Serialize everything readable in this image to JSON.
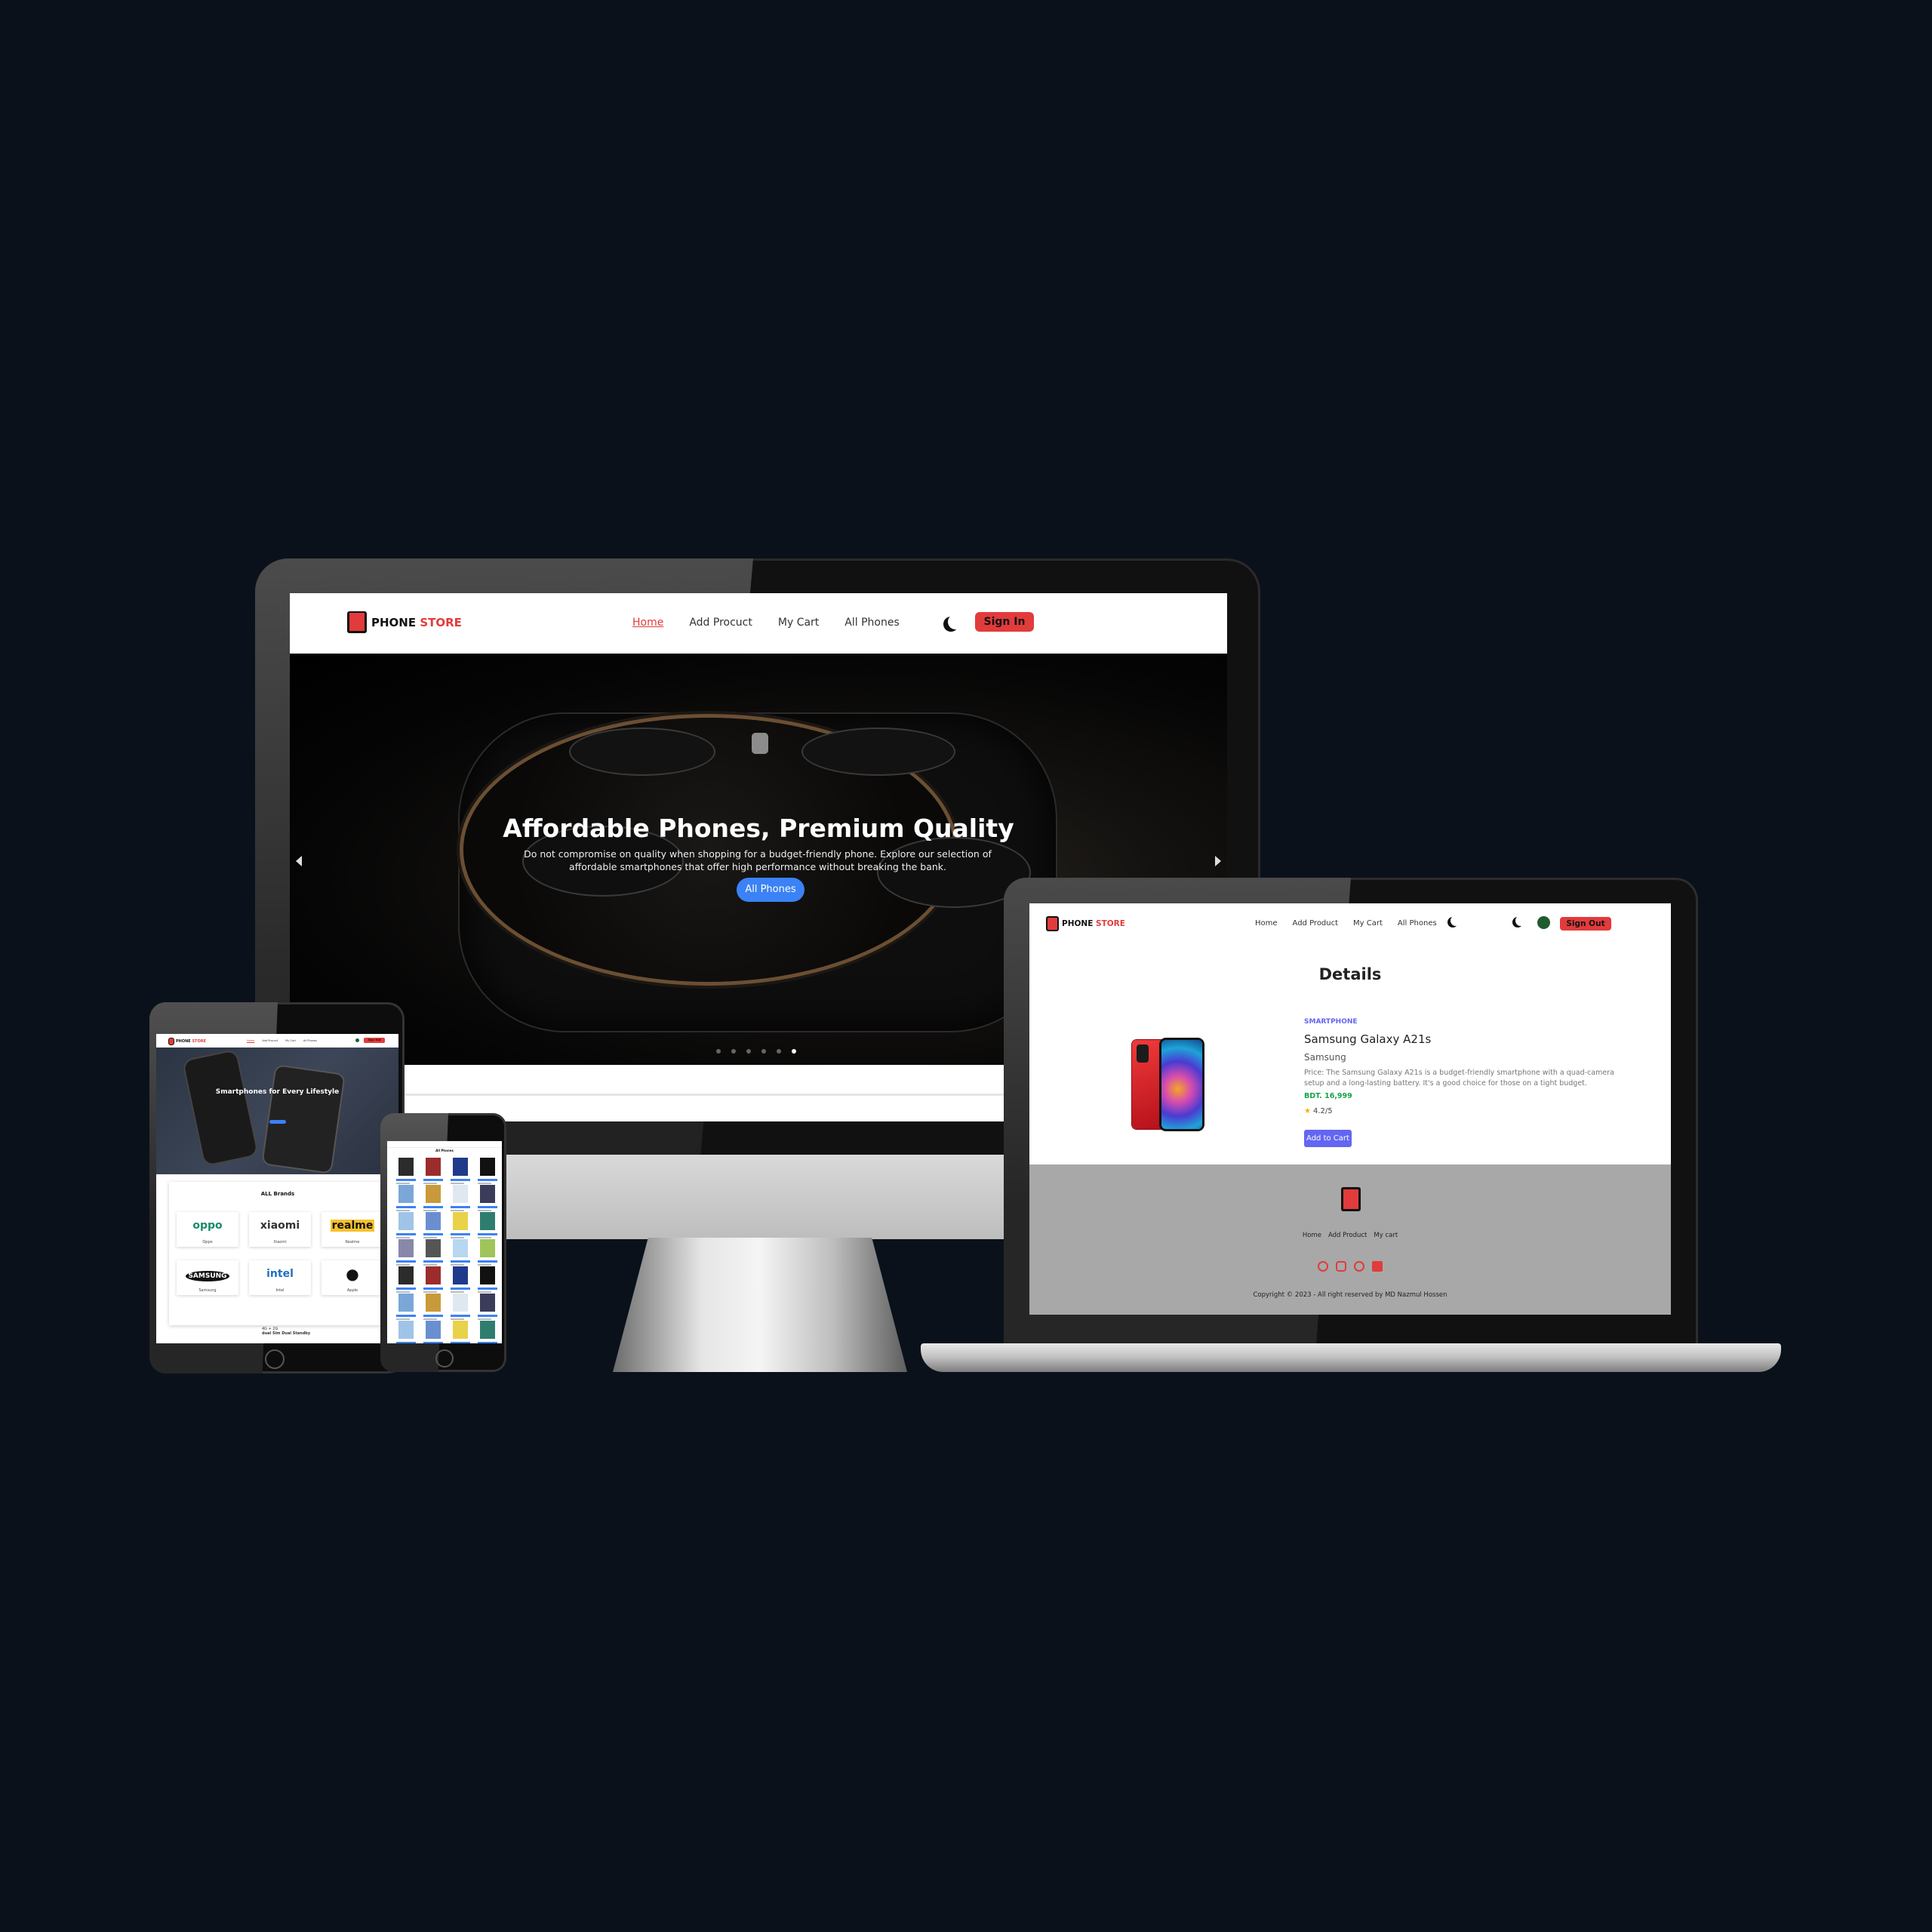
{
  "brand": {
    "name_part1": "PHONE",
    "name_part2": "STORE"
  },
  "desktop": {
    "nav": [
      "Home",
      "Add Procuct",
      "My Cart",
      "All Phones"
    ],
    "signin_label": "Sign In",
    "hero": {
      "title": "Affordable Phones, Premium Quality",
      "subtitle": "Do not compromise on quality when shopping for a budget-friendly phone. Explore our selection of affordable smartphones that offer high performance without breaking the bank.",
      "button": "All Phones",
      "slide_count": 6,
      "active_slide": 6
    }
  },
  "laptop": {
    "nav": [
      "Home",
      "Add Product",
      "My Cart",
      "All Phones"
    ],
    "signout_label": "Sign Out",
    "page_title": "Details",
    "product": {
      "category": "SMARTPHONE",
      "name": "Samsung Galaxy A21s",
      "brand": "Samsung",
      "description": "Price: The Samsung Galaxy A21s is a budget-friendly smartphone with a quad-camera setup and a long-lasting battery. It's a good choice for those on a tight budget.",
      "price": "BDT. 16,999",
      "rating": "4.2/5",
      "add_to_cart": "Add to Cart"
    },
    "footer": {
      "links": [
        "Home",
        "Add Product",
        "My cart"
      ],
      "social_icons": [
        "facebook-icon",
        "instagram-icon",
        "github-icon",
        "linkedin-icon"
      ],
      "copyright": "Copyright © 2023 - All right reserved by MD Nazmul Hossen"
    }
  },
  "tablet": {
    "hero_title": "Smartphones for Every Lifestyle",
    "brands_title": "ALL Brands",
    "brands": [
      {
        "logo": "oppo",
        "name": "Oppo"
      },
      {
        "logo": "xiaomi",
        "name": "Xiaomi"
      },
      {
        "logo": "realme",
        "name": "Realme"
      },
      {
        "logo": "SAMSUNG",
        "name": "Samsung"
      },
      {
        "logo": "intel",
        "name": "Intel"
      },
      {
        "logo": "",
        "name": "Apple"
      }
    ],
    "promo_line1": "4G + 2G",
    "promo_line2": "dual Sim Dual Standby"
  },
  "phone": {
    "title": "All Phones"
  },
  "colors": {
    "accent_red": "#e23b3b",
    "accent_blue": "#3b82f6",
    "add_to_cart_purple": "#6366f1",
    "price_green": "#16a34a",
    "footer_gray": "#a8a8a8",
    "background": "#0b111a"
  }
}
